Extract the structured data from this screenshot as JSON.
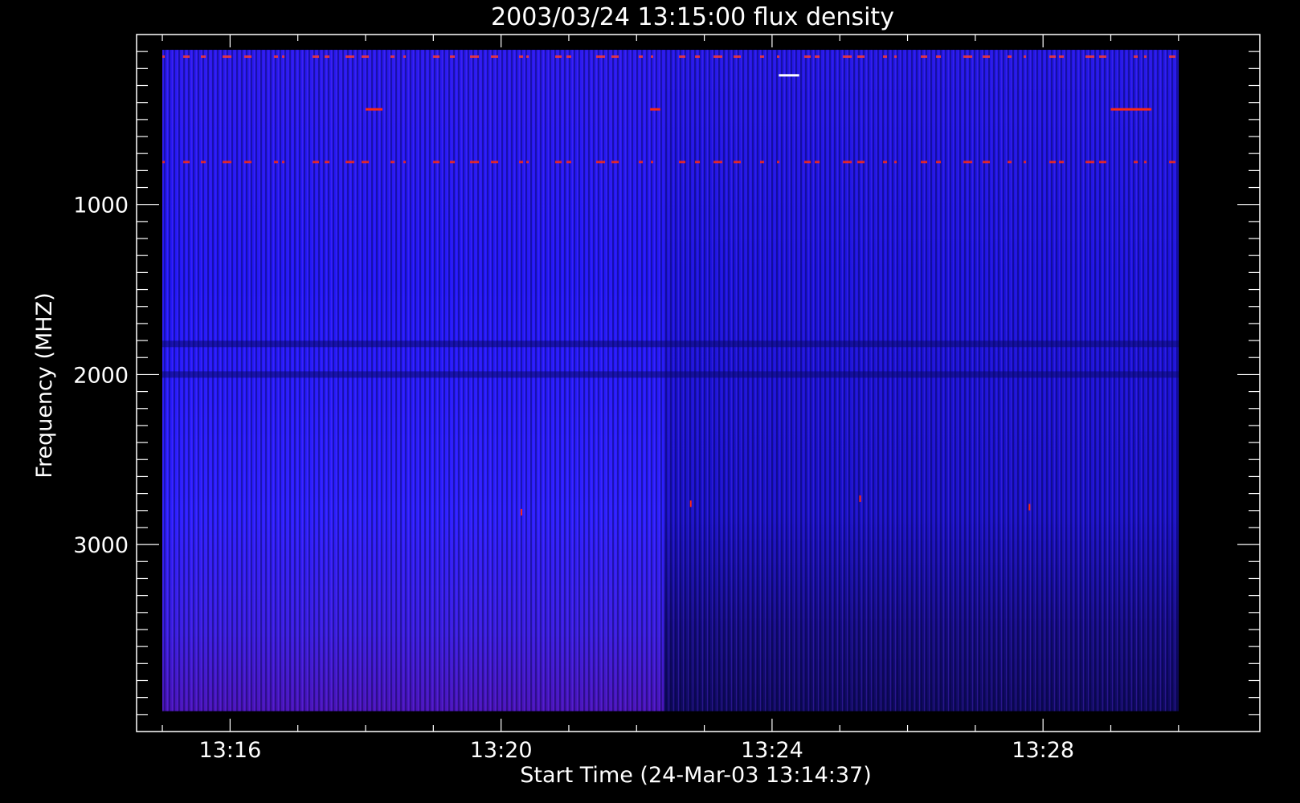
{
  "chart_data": {
    "type": "heatmap",
    "title": "2003/03/24 13:15:00 flux density",
    "xlabel": "Start Time (24-Mar-03 13:14:37)",
    "ylabel": "Frequency (MHZ)",
    "x_ticks": [
      "13:16",
      "13:20",
      "13:24",
      "13:28"
    ],
    "x_tick_minutes": [
      16,
      20,
      24,
      28
    ],
    "xlim_minutes": [
      14.62,
      31.2
    ],
    "data_x_minutes": [
      15.0,
      30.0
    ],
    "y_ticks": [
      1000,
      2000,
      3000
    ],
    "ylim": [
      0,
      4100
    ],
    "data_y": [
      90,
      3980
    ],
    "y_inverted": true,
    "grid": false,
    "colors": {
      "background": "#000000",
      "axes": "#ffffff",
      "low": "#1a1ad0",
      "mid": "#2a1cff",
      "high": "#ff2a10"
    },
    "features": [
      {
        "kind": "hband",
        "freq": 130,
        "t0": 15.0,
        "t1": 30.0,
        "level": "mixed"
      },
      {
        "kind": "hband",
        "freq": 750,
        "t0": 15.0,
        "t1": 30.0,
        "level": "high"
      },
      {
        "kind": "hband",
        "freq": 1820,
        "t0": 15.0,
        "t1": 30.0,
        "level": "dark"
      },
      {
        "kind": "hband",
        "freq": 2000,
        "t0": 15.0,
        "t1": 30.0,
        "level": "dark"
      },
      {
        "kind": "segment",
        "freq": 440,
        "t0": 18.0,
        "t1": 18.25,
        "level": "high"
      },
      {
        "kind": "segment",
        "freq": 440,
        "t0": 29.0,
        "t1": 29.6,
        "level": "high"
      },
      {
        "kind": "segment",
        "freq": 440,
        "t0": 22.2,
        "t1": 22.35,
        "level": "high"
      },
      {
        "kind": "segment",
        "freq": 240,
        "t0": 24.1,
        "t1": 24.4,
        "level": "white"
      },
      {
        "kind": "spot",
        "freq": 2810,
        "t": 20.3,
        "level": "high"
      },
      {
        "kind": "spot",
        "freq": 2760,
        "t": 22.8,
        "level": "high"
      },
      {
        "kind": "spot",
        "freq": 2730,
        "t": 25.3,
        "level": "high"
      },
      {
        "kind": "spot",
        "freq": 2780,
        "t": 27.8,
        "level": "high"
      },
      {
        "kind": "step",
        "t": 22.4,
        "note": "background level drops after this time"
      }
    ]
  }
}
